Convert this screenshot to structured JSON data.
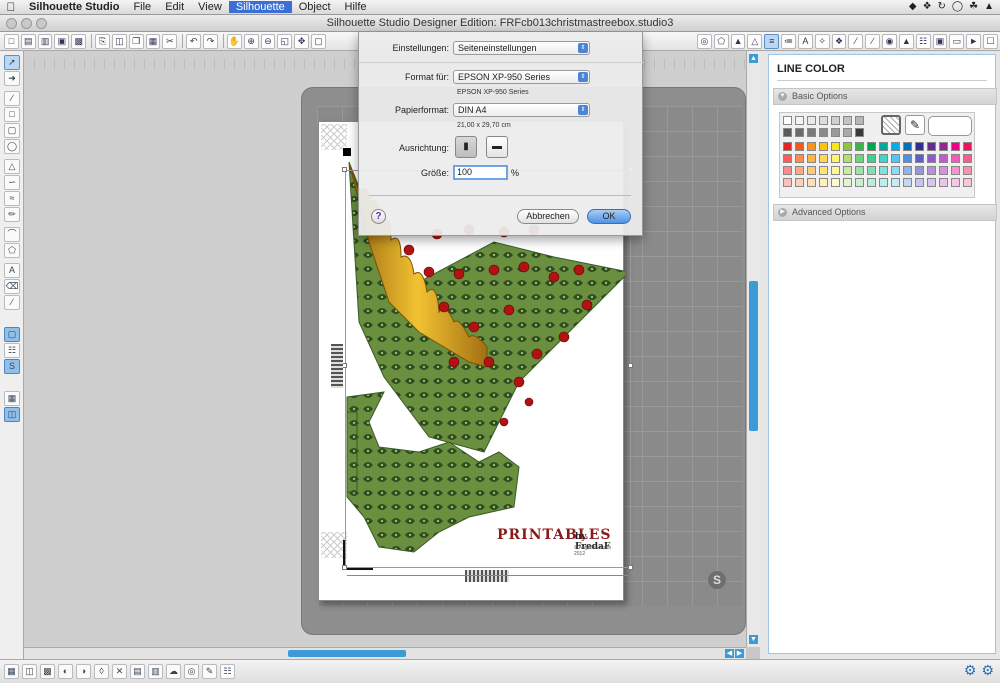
{
  "menubar": {
    "items": [
      "Silhouette Studio",
      "File",
      "Edit",
      "View",
      "Silhouette",
      "Object",
      "Hilfe"
    ],
    "active_item": "Silhouette"
  },
  "window": {
    "title": "Silhouette Studio Designer Edition: FRFcb013christmastreebox.studio3"
  },
  "canvas": {
    "watermark_title": "PRINTABLES",
    "watermark_byline": "by FredaF",
    "watermark_copyright": "© Angelika Hahn 2012"
  },
  "right_panel": {
    "title": "LINE COLOR",
    "basic_options_label": "Basic Options",
    "advanced_options_label": "Advanced Options",
    "swatches": [
      [
        "#ffffff",
        "#f4f4f4",
        "#e8e8e8",
        "#dcdcdc",
        "#d0d0d0",
        "#c4c4c4",
        "#b8b8b8"
      ],
      [
        "#5a5a5a",
        "#6a6a6a",
        "#7a7a7a",
        "#8a8a8a",
        "#9a9a9a",
        "#aaaaaa",
        "#3a3a3a"
      ],
      [
        "#e8231f",
        "#f05a1a",
        "#f7941d",
        "#fcc30d",
        "#f4e81a",
        "#8dc63f",
        "#39b54a",
        "#00a651",
        "#00a99d",
        "#00aeef",
        "#0072bc",
        "#2e3192",
        "#662d91",
        "#92278f",
        "#ec008c",
        "#ed145b"
      ],
      [
        "#ff5b5b",
        "#ff8a4d",
        "#ffb347",
        "#ffd84d",
        "#fff46b",
        "#b2e06b",
        "#6ad57a",
        "#3fd08e",
        "#3fd3c9",
        "#4fc8f5",
        "#4f8fdb",
        "#5a5fc9",
        "#8f5bc9",
        "#c05bc9",
        "#f45bb8",
        "#f4608a"
      ],
      [
        "#ff8c8c",
        "#ffab7d",
        "#ffc97d",
        "#ffe47d",
        "#fff89b",
        "#ccec9b",
        "#9be4a6",
        "#7fe0b3",
        "#7fe3dc",
        "#8fdaf8",
        "#8fb5ea",
        "#9497dc",
        "#b393dc",
        "#d593dc",
        "#f893d0",
        "#f894ae"
      ],
      [
        "#ffbdbd",
        "#ffcfb5",
        "#ffe0b5",
        "#fff0b5",
        "#fffbc8",
        "#e2f5c8",
        "#c8f0cf",
        "#b8eed6",
        "#b8f0ec",
        "#c3ebfb",
        "#c3d6f4",
        "#c6c7ee",
        "#d6c5ee",
        "#e8c5ee",
        "#fbc5e7",
        "#fbc6d5"
      ]
    ]
  },
  "print_dialog": {
    "settings_label": "Einstellungen:",
    "settings_value": "Seiteneinstellungen",
    "format_for_label": "Format für:",
    "format_for_value": "EPSON XP-950 Series",
    "format_for_sub": "EPSON XP-950 Series",
    "paper_label": "Papierformat:",
    "paper_value": "DIN A4",
    "paper_size": "21,00 x 29,70 cm",
    "orientation_label": "Ausrichtung:",
    "scale_label": "Größe:",
    "scale_value": "100",
    "scale_unit": "%",
    "help_glyph": "?",
    "cancel_label": "Abbrechen",
    "ok_label": "OK"
  }
}
